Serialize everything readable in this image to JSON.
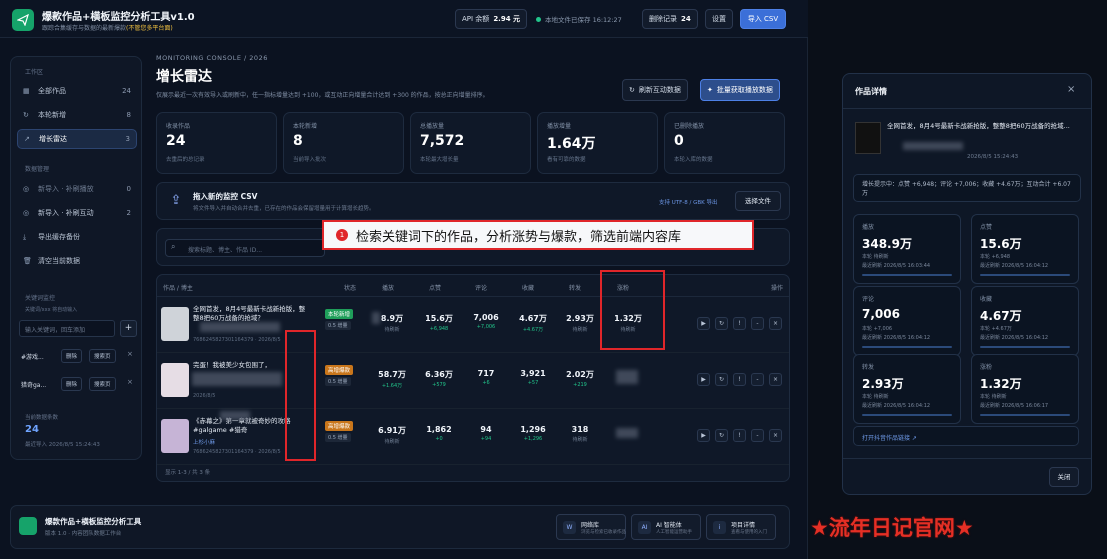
{
  "app": {
    "title": "爆款作品+横板监控分析工具v1.0",
    "subtitle": "跟踪合集缓存与数据的最新爆款",
    "subtitle_highlight": "(不管您多平台面)",
    "api_label": "API 余额",
    "api_value": "2.94 元",
    "saved_status": "本地文件已保存 16:12:27",
    "delete_label": "删除记录",
    "delete_count": "24",
    "settings_label": "设置",
    "import_label": "导入 CSV"
  },
  "sidebar": {
    "section_workspace": "工作区",
    "items": [
      {
        "label": "全部作品",
        "count": "24",
        "icon": "grid-icon"
      },
      {
        "label": "本轮新增",
        "count": "8",
        "icon": "refresh-icon"
      },
      {
        "label": "增长雷达",
        "count": "3",
        "icon": "trend-icon"
      }
    ],
    "section_data": "数据管理",
    "data_items": [
      {
        "label": "新导入 · 补刷播放",
        "count": "0"
      },
      {
        "label": "新导入 · 补刷互动",
        "count": "2"
      },
      {
        "label": "导出缓存备份",
        "count": ""
      },
      {
        "label": "清空当前数据",
        "count": ""
      }
    ],
    "section_keywords": "关键词监控",
    "keyword_hint": "关键词/xxx 将自动输入",
    "keyword_placeholder": "输入关键词，回车添加",
    "keywords": [
      {
        "label": "#游戏...",
        "b1": "删除",
        "b2": "搜索页"
      },
      {
        "label": "猎奇ga...",
        "b1": "删除",
        "b2": "搜索页"
      }
    ],
    "last_import_label": "当前数据条数",
    "last_import_value": "24",
    "last_import_time": "最近导入 2026/8/5 15:24:43"
  },
  "main": {
    "eyebrow": "MONITORING CONSOLE / 2026",
    "title": "增长雷达",
    "desc": "仅展示最近一次有效导入或刷新中，任一指标增量达到 +100，或互动正向增量合计达到 +300 的作品，按总正向增量排序。",
    "refresh_label": "刷新互动数据",
    "batch_label": "批量获取播放数据",
    "stats": [
      {
        "label": "收录作品",
        "value": "24",
        "note": "去重后的总记录"
      },
      {
        "label": "本轮新增",
        "value": "8",
        "note": "当前导入批次"
      },
      {
        "label": "总播放量",
        "value": "7,572",
        "note": "本轮最大增长量"
      },
      {
        "label": "播放增量",
        "value": "1.64万",
        "note": "看有可靠的数据"
      },
      {
        "label": "已删除播放",
        "value": "0",
        "note": "本轮入库的数据"
      }
    ],
    "import_title": "拖入新的监控 CSV",
    "import_desc": "将文件导入并自动合并去重，已存在的作品会保留增量用于计算增长趋势。",
    "import_support": "支持 UTF-8 / GBK 导出",
    "import_button": "选择文件",
    "search_placeholder": "搜索标题、博主、作品 ID...",
    "table_headers": [
      "作品 / 博主",
      "状态",
      "播放",
      "点赞",
      "评论",
      "收藏",
      "转发",
      "涨粉",
      "操作"
    ],
    "rows": [
      {
        "title": "全网首发，8月4号最新卡战新抢版，整整8把60万战备的抢域？",
        "meta": "7686245827301164379 · 2026/8/5",
        "tag": "本轮新增",
        "tag_color": "#1f9e5a",
        "tag2": "0.5 增量",
        "thumb": "#d0d4da",
        "play": "8.9万",
        "play_sub": "待刷新",
        "like": "15.6万",
        "like_sub": "+6,948",
        "comment": "7,006",
        "comment_sub": "+7,006",
        "fav": "4.67万",
        "fav_sub": "+4.67万",
        "share": "2.93万",
        "share_sub": "待刷新",
        "fans": "1.32万",
        "fans_sub": "待刷新"
      },
      {
        "title": "完蛋！我被美少女包围了，",
        "meta": "2026/8/5",
        "tag": "高增爆款",
        "tag_color": "#c9761b",
        "tag2": "0.5 增量",
        "thumb": "#e8dfe6",
        "play": "58.7万",
        "play_sub": "+1.64万",
        "like": "6.36万",
        "like_sub": "+579",
        "comment": "717",
        "comment_sub": "+6",
        "fav": "3,921",
        "fav_sub": "+57",
        "share": "2.02万",
        "share_sub": "+219",
        "fans": "",
        "fans_sub": ""
      },
      {
        "title": "《赤幕之》第一章就被奇妙的攻略#galgame #猎奇",
        "meta": "7686245827301164379 · 2026/8/5",
        "author": "上杉小麻",
        "tag": "高增爆款",
        "tag_color": "#c9761b",
        "tag2": "0.5 增量",
        "thumb": "#c8b6d8",
        "play": "6.91万",
        "play_sub": "待刷新",
        "like": "1,862",
        "like_sub": "+0",
        "comment": "94",
        "comment_sub": "+94",
        "fav": "1,296",
        "fav_sub": "+1,296",
        "share": "318",
        "share_sub": "待刷新",
        "fans": "",
        "fans_sub": ""
      }
    ],
    "footer": "显示 1-3 / 共 3 条"
  },
  "overlay": {
    "text": "检索关键词下的作品，分析涨势与爆款，筛选前端内容库",
    "badge": "1"
  },
  "detail": {
    "title": "作品详情",
    "work_title": "全网首发，8月4号最新卡战新抢版，整整8把60万战备的抢域...",
    "work_meta": "2026/8/5 15:24:43",
    "summary": "增长提示中：点赞 +6,948；评论 +7,006；收藏 +4.67万；互动合计 +6.07万",
    "cards": [
      {
        "label": "播放",
        "value": "348.9万",
        "s1": "本轮 待刷新",
        "s2": "最近刷新 2026/8/5 16:03:44"
      },
      {
        "label": "点赞",
        "value": "15.6万",
        "s1": "本轮 +6,948",
        "s2": "最近刷新 2026/8/5 16:04:12"
      },
      {
        "label": "评论",
        "value": "7,006",
        "s1": "本轮 +7,006",
        "s2": "最近刷新 2026/8/5 16:04:12"
      },
      {
        "label": "收藏",
        "value": "4.67万",
        "s1": "本轮 +4.67万",
        "s2": "最近刷新 2026/8/5 16:04:12"
      },
      {
        "label": "转发",
        "value": "2.93万",
        "s1": "本轮 待刷新",
        "s2": "最近刷新 2026/8/5 16:04:12"
      },
      {
        "label": "涨粉",
        "value": "1.32万",
        "s1": "本轮 待刷新",
        "s2": "最近刷新 2026/8/5 16:06:17"
      }
    ],
    "link": "打开抖音作品链接 ↗",
    "close_label": "关闭"
  },
  "bottom": {
    "title": "爆款作品+横板监控分析工具",
    "sub": "版本 1.0 · 内容团队数据工作台",
    "buttons": [
      {
        "t": "网络库",
        "s": "浏览与检索已收录作品",
        "i": "W"
      },
      {
        "t": "AI 智能体",
        "s": "人工智能运营助手",
        "i": "AI"
      },
      {
        "t": "项目详情",
        "s": "查看与使用的入门",
        "i": "i"
      }
    ]
  },
  "watermark": "★流年日记官网★"
}
